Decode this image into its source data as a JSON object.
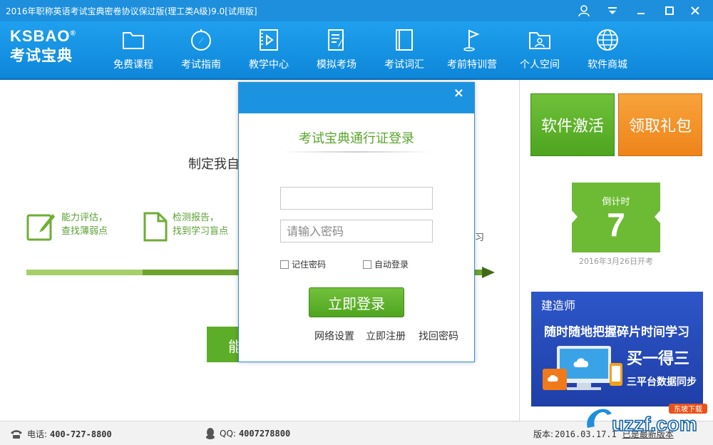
{
  "window": {
    "title": "2016年职称英语考试宝典密卷协议保过版(理工类A级)9.0[试用版]"
  },
  "logo": {
    "en": "KSBAO",
    "reg": "®",
    "cn": "考试宝典"
  },
  "nav": {
    "items": [
      {
        "label": "免费课程",
        "icon": "folder-icon"
      },
      {
        "label": "考试指南",
        "icon": "compass-icon"
      },
      {
        "label": "教学中心",
        "icon": "video-icon"
      },
      {
        "label": "模拟考场",
        "icon": "exam-paper-icon"
      },
      {
        "label": "考试词汇",
        "icon": "book-icon"
      },
      {
        "label": "考前特训营",
        "icon": "flag-icon"
      },
      {
        "label": "个人空间",
        "icon": "user-folder-icon"
      },
      {
        "label": "软件商城",
        "icon": "globe-icon"
      }
    ]
  },
  "main": {
    "plan_title": "制定我自",
    "features": [
      {
        "line1": "能力评估，",
        "line2": "查找薄弱点",
        "icon": "edit-icon"
      },
      {
        "line1": "检测报告，",
        "line2": "找到学习盲点",
        "icon": "document-icon"
      }
    ],
    "behind_text": "习",
    "big_button_text": "能"
  },
  "right": {
    "activate_label": "软件激活",
    "gift_label": "领取礼包",
    "countdown_caption": "倒计时",
    "countdown_days": "7",
    "exam_date": "2016年3月26日开考",
    "ad": {
      "t1": "建造师",
      "t2": "随时随地把握碎片时间学习",
      "t3": "买一得三",
      "t4": "三平台数据同步"
    }
  },
  "status": {
    "phone_label": "电话:",
    "phone": "400-727-8800",
    "qq_label": "QQ:",
    "qq": "4007278800",
    "version_label": "版本:",
    "version": "2016.03.17.1",
    "update": "已是最新版本",
    "watermark": "uzzf.com",
    "watermark_sub": "东坡下载"
  },
  "login": {
    "title": "考试宝典通行证登录",
    "username_value": "",
    "password_placeholder": "请输入密码",
    "remember_label": "记住密码",
    "autologin_label": "自动登录",
    "login_label": "立即登录",
    "links": [
      "网络设置",
      "立即注册",
      "找回密码"
    ],
    "close": "×"
  },
  "colors": {
    "titlebar": "#1d8fdd",
    "nav": "#1fa0ee",
    "green": "#5aa52d",
    "orange": "#ee841a",
    "ad_blue": "#2d56c8"
  }
}
